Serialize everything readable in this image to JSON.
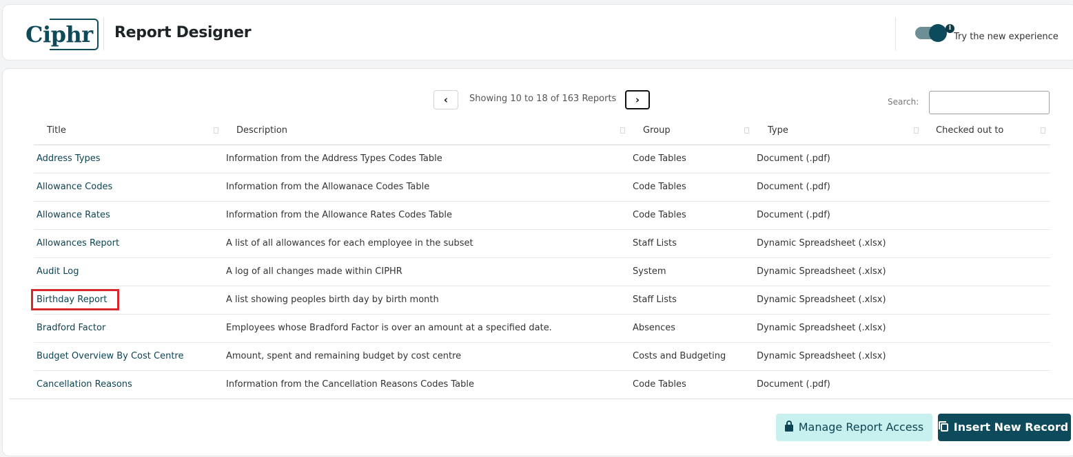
{
  "header": {
    "logo_main": "Ci",
    "logo_box": "phr",
    "title": "Report Designer",
    "toggle_label": "Try the new experience",
    "info_icon": "i"
  },
  "pager": {
    "prev_icon": "chevron-left",
    "next_icon": "chevron-right",
    "text": "Showing 10 to 18 of 163 Reports"
  },
  "search": {
    "label": "Search:",
    "value": ""
  },
  "columns": [
    "Title",
    "Description",
    "Group",
    "Type",
    "Checked out to"
  ],
  "rows": [
    {
      "title": "Address Types",
      "desc": "Information from the Address Types Codes Table",
      "group": "Code Tables",
      "type": "Document (.pdf)",
      "checked": ""
    },
    {
      "title": "Allowance Codes",
      "desc": "Information from the Allowanace Codes Table",
      "group": "Code Tables",
      "type": "Document (.pdf)",
      "checked": ""
    },
    {
      "title": "Allowance Rates",
      "desc": "Information from the Allowance Rates Codes Table",
      "group": "Code Tables",
      "type": "Document (.pdf)",
      "checked": ""
    },
    {
      "title": "Allowances Report",
      "desc": "A list of all allowances for each employee in the subset",
      "group": "Staff Lists",
      "type": "Dynamic Spreadsheet (.xlsx)",
      "checked": ""
    },
    {
      "title": "Audit Log",
      "desc": "A log of all changes made within CIPHR",
      "group": "System",
      "type": "Dynamic Spreadsheet (.xlsx)",
      "checked": ""
    },
    {
      "title": "Birthday Report",
      "desc": "A list showing peoples birth day by birth month",
      "group": "Staff Lists",
      "type": "Dynamic Spreadsheet (.xlsx)",
      "checked": ""
    },
    {
      "title": "Bradford Factor",
      "desc": "Employees whose Bradford Factor is over an amount at a specified date.",
      "group": "Absences",
      "type": "Dynamic Spreadsheet (.xlsx)",
      "checked": ""
    },
    {
      "title": "Budget Overview By Cost Centre",
      "desc": "Amount, spent and remaining budget by cost centre",
      "group": "Costs and Budgeting",
      "type": "Dynamic Spreadsheet (.xlsx)",
      "checked": ""
    },
    {
      "title": "Cancellation Reasons",
      "desc": "Information from the Cancellation Reasons Codes Table",
      "group": "Code Tables",
      "type": "Document (.pdf)",
      "checked": ""
    }
  ],
  "actions": {
    "manage_label": "Manage Report Access",
    "insert_label": "Insert New Record"
  },
  "colors": {
    "brand": "#0d4a5b",
    "highlight": "#d9262b",
    "manage_bg": "#c7f0ee"
  }
}
